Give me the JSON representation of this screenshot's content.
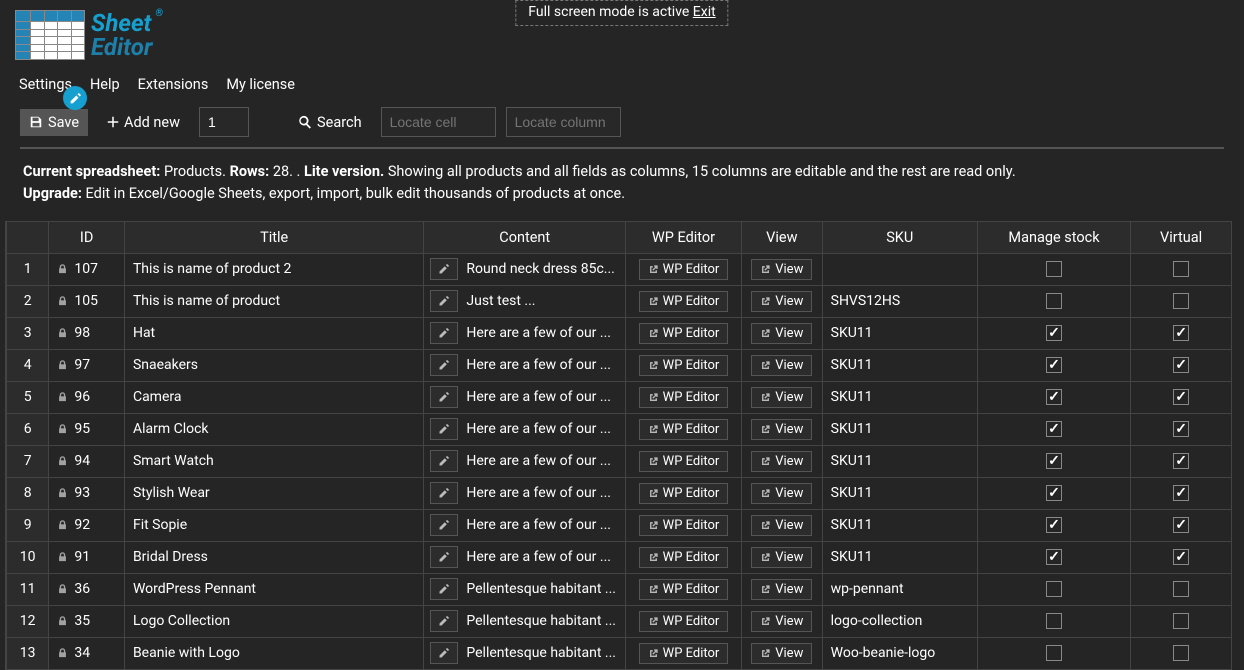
{
  "fullscreen": {
    "msg": "Full screen mode is active",
    "exit": "Exit"
  },
  "logo": {
    "line1": "Sheet",
    "line2": "Editor"
  },
  "menu": {
    "settings": "Settings",
    "help": "Help",
    "extensions": "Extensions",
    "license": "My license"
  },
  "toolbar": {
    "save": "Save",
    "addnew": "Add new",
    "addnew_qty": "1",
    "search": "Search",
    "locate_cell_ph": "Locate cell",
    "locate_col_ph": "Locate column"
  },
  "info": {
    "label1": "Current spreadsheet:",
    "val1": "Products.",
    "label2": "Rows:",
    "val2": "28. .",
    "lite": "Lite version.",
    "desc": "Showing all products and all fields as columns, 15 columns are editable and the rest are read only.",
    "upgrade_label": "Upgrade:",
    "upgrade_desc": "Edit in Excel/Google Sheets, export, import, bulk edit thousands of products at once."
  },
  "headers": {
    "id": "ID",
    "title": "Title",
    "content": "Content",
    "wpe": "WP Editor",
    "view": "View",
    "sku": "SKU",
    "ms": "Manage stock",
    "virt": "Virtual"
  },
  "btn": {
    "wpe": "WP Editor",
    "view": "View"
  },
  "rows": [
    {
      "n": "1",
      "id": "107",
      "title": "This is name of product 2",
      "content": "Round neck dress 85c...",
      "sku": "",
      "ms": false,
      "virt": false
    },
    {
      "n": "2",
      "id": "105",
      "title": "This is name of product",
      "content": "Just test ...",
      "sku": "SHVS12HS",
      "ms": false,
      "virt": false
    },
    {
      "n": "3",
      "id": "98",
      "title": "Hat",
      "content": "Here are a few of our ...",
      "sku": "SKU11",
      "ms": true,
      "virt": true
    },
    {
      "n": "4",
      "id": "97",
      "title": "Snaeakers",
      "content": "Here are a few of our ...",
      "sku": "SKU11",
      "ms": true,
      "virt": true
    },
    {
      "n": "5",
      "id": "96",
      "title": "Camera",
      "content": "Here are a few of our ...",
      "sku": "SKU11",
      "ms": true,
      "virt": true
    },
    {
      "n": "6",
      "id": "95",
      "title": "Alarm Clock",
      "content": "Here are a few of our ...",
      "sku": "SKU11",
      "ms": true,
      "virt": true
    },
    {
      "n": "7",
      "id": "94",
      "title": "Smart Watch",
      "content": "Here are a few of our ...",
      "sku": "SKU11",
      "ms": true,
      "virt": true
    },
    {
      "n": "8",
      "id": "93",
      "title": "Stylish Wear",
      "content": "Here are a few of our ...",
      "sku": "SKU11",
      "ms": true,
      "virt": true
    },
    {
      "n": "9",
      "id": "92",
      "title": "Fit Sopie",
      "content": "Here are a few of our ...",
      "sku": "SKU11",
      "ms": true,
      "virt": true
    },
    {
      "n": "10",
      "id": "91",
      "title": "Bridal Dress",
      "content": "Here are a few of our ...",
      "sku": "SKU11",
      "ms": true,
      "virt": true
    },
    {
      "n": "11",
      "id": "36",
      "title": "WordPress Pennant",
      "content": "Pellentesque habitant ...",
      "sku": "wp-pennant",
      "ms": false,
      "virt": false
    },
    {
      "n": "12",
      "id": "35",
      "title": "Logo Collection",
      "content": "Pellentesque habitant ...",
      "sku": "logo-collection",
      "ms": false,
      "virt": false
    },
    {
      "n": "13",
      "id": "34",
      "title": "Beanie with Logo",
      "content": "Pellentesque habitant ...",
      "sku": "Woo-beanie-logo",
      "ms": false,
      "virt": false
    }
  ]
}
